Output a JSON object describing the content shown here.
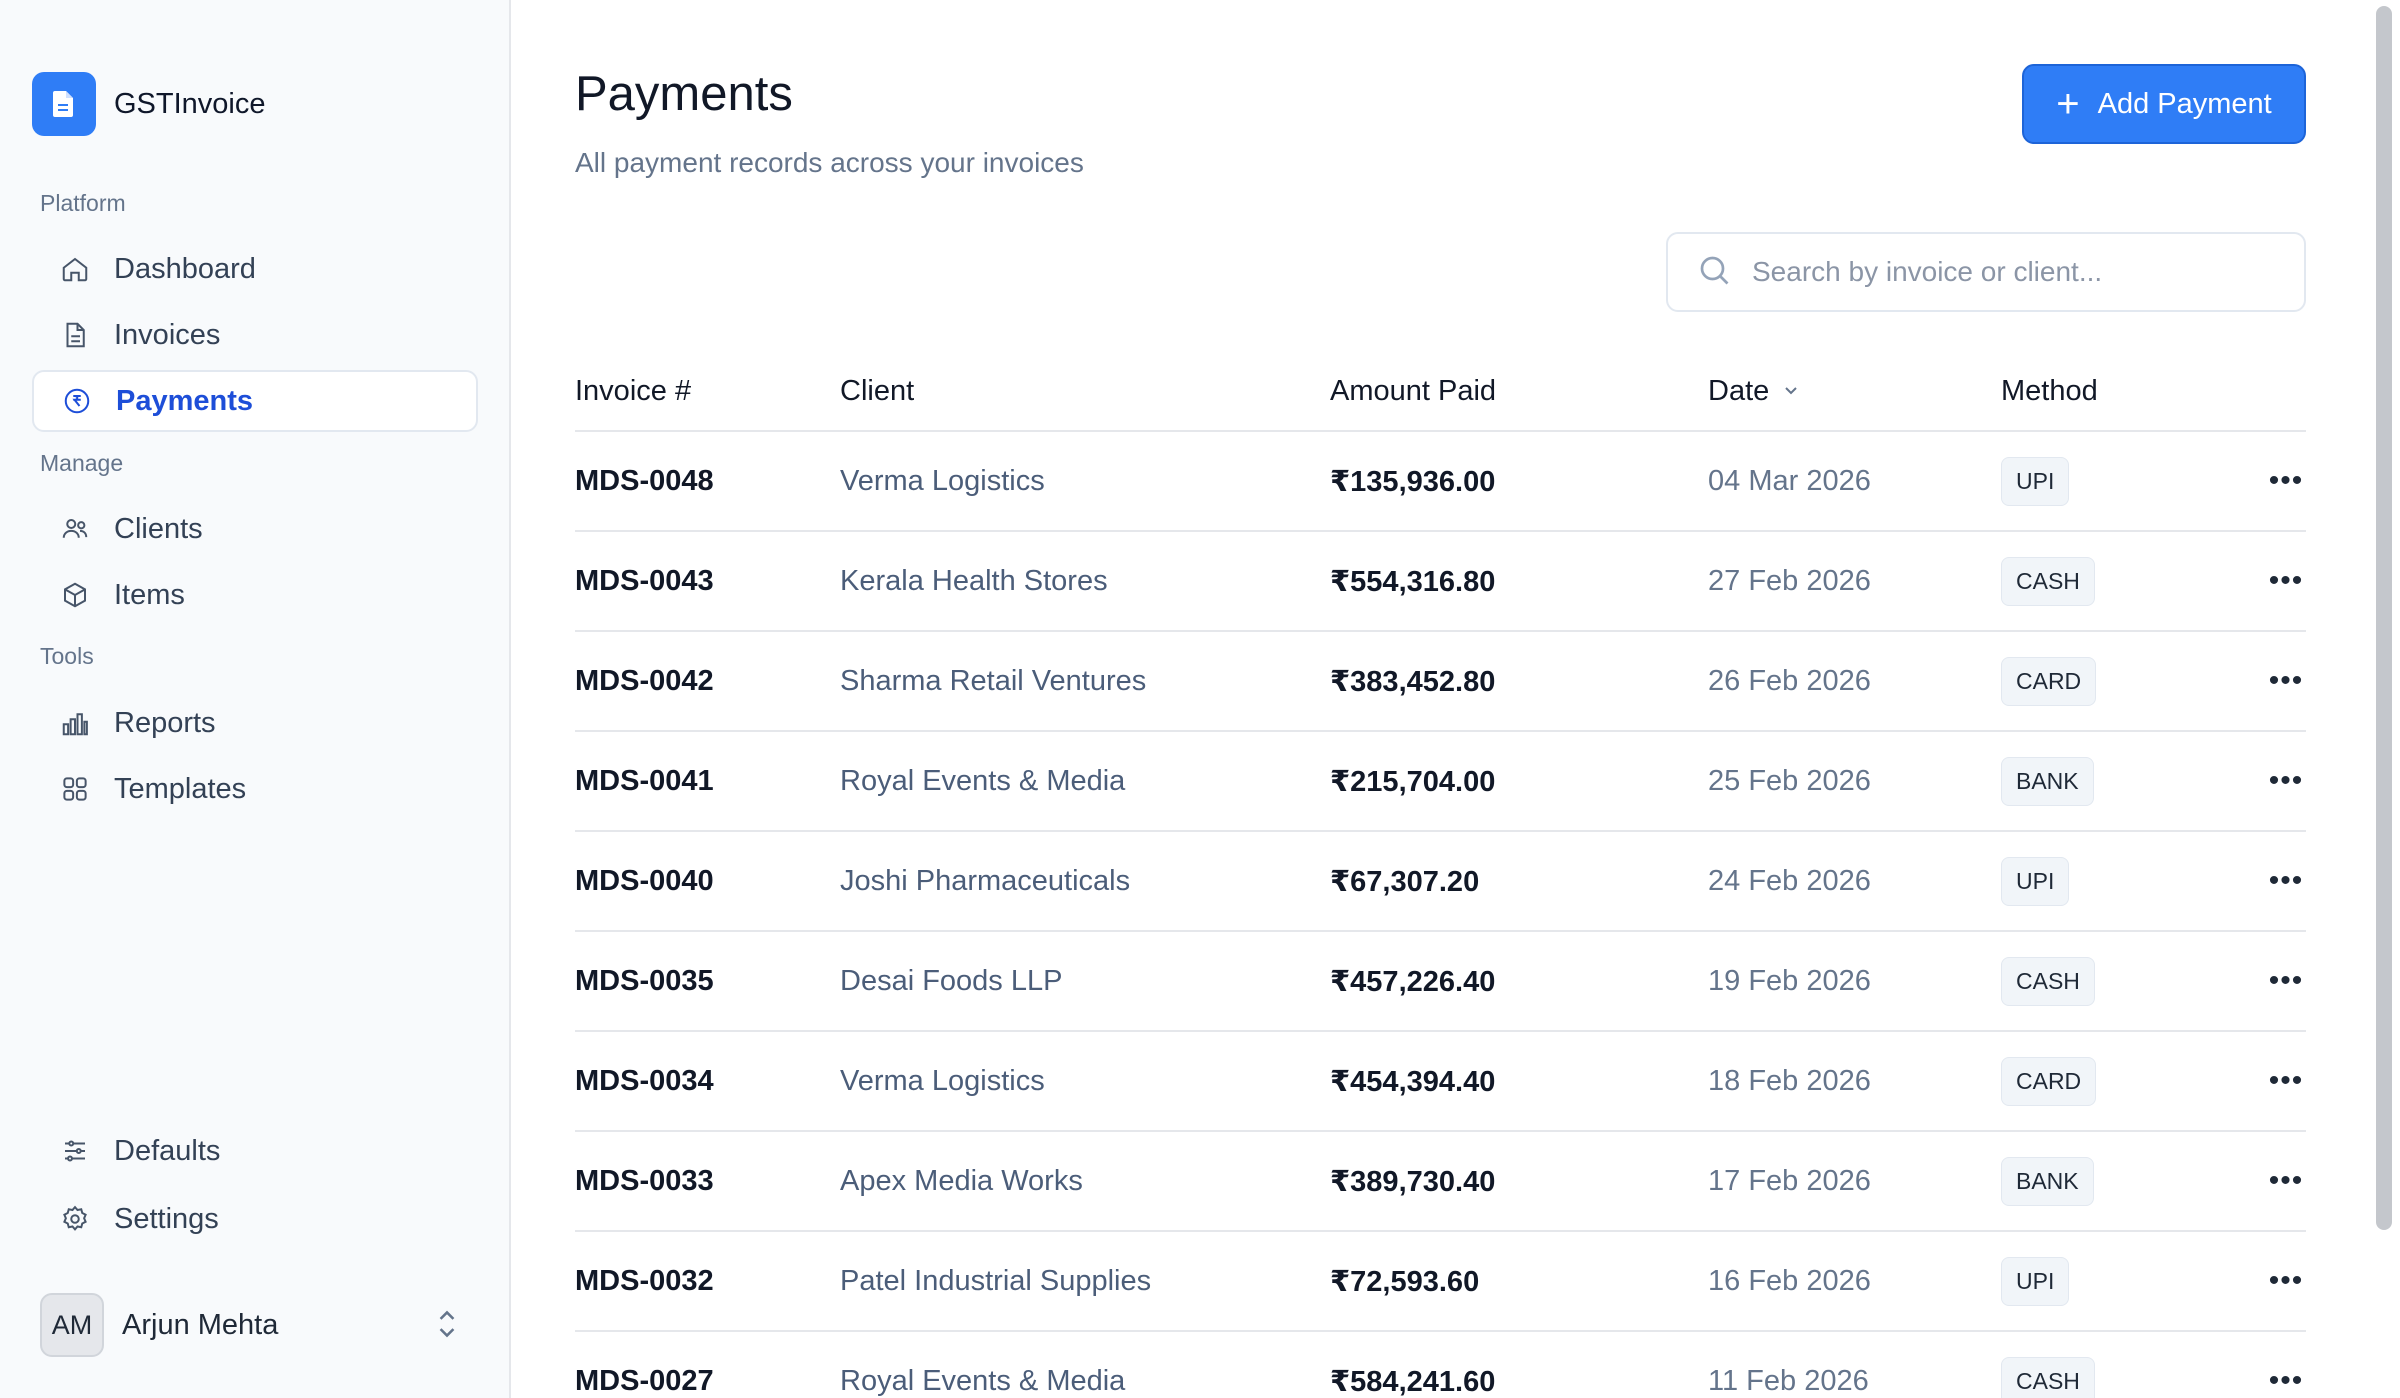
{
  "brand": {
    "name": "GSTInvoice",
    "logo_icon": "document-icon",
    "accent": "#2f7df6"
  },
  "sidebar": {
    "sections": {
      "platform": "Platform",
      "manage": "Manage",
      "tools": "Tools"
    },
    "items": [
      {
        "label": "Dashboard",
        "icon": "home-icon"
      },
      {
        "label": "Invoices",
        "icon": "file-icon"
      },
      {
        "label": "Payments",
        "icon": "rupee-circle-icon",
        "active": true
      },
      {
        "label": "Clients",
        "icon": "users-icon"
      },
      {
        "label": "Items",
        "icon": "box-icon"
      },
      {
        "label": "Reports",
        "icon": "bar-chart-icon"
      },
      {
        "label": "Templates",
        "icon": "grid-icon"
      },
      {
        "label": "Defaults",
        "icon": "sliders-icon"
      },
      {
        "label": "Settings",
        "icon": "gear-icon"
      }
    ],
    "user": {
      "initials": "AM",
      "name": "Arjun Mehta"
    }
  },
  "header": {
    "title": "Payments",
    "subtitle": "All payment records across your invoices",
    "add_button": "Add Payment"
  },
  "search": {
    "placeholder": "Search by invoice or client..."
  },
  "table": {
    "columns": [
      "Invoice #",
      "Client",
      "Amount Paid",
      "Date",
      "Method"
    ],
    "rows": [
      {
        "invoice": "MDS-0048",
        "client": "Verma Logistics",
        "amount": "₹135,936.00",
        "date": "04 Mar 2026",
        "method": "UPI"
      },
      {
        "invoice": "MDS-0043",
        "client": "Kerala Health Stores",
        "amount": "₹554,316.80",
        "date": "27 Feb 2026",
        "method": "CASH"
      },
      {
        "invoice": "MDS-0042",
        "client": "Sharma Retail Ventures",
        "amount": "₹383,452.80",
        "date": "26 Feb 2026",
        "method": "CARD"
      },
      {
        "invoice": "MDS-0041",
        "client": "Royal Events & Media",
        "amount": "₹215,704.00",
        "date": "25 Feb 2026",
        "method": "BANK"
      },
      {
        "invoice": "MDS-0040",
        "client": "Joshi Pharmaceuticals",
        "amount": "₹67,307.20",
        "date": "24 Feb 2026",
        "method": "UPI"
      },
      {
        "invoice": "MDS-0035",
        "client": "Desai Foods LLP",
        "amount": "₹457,226.40",
        "date": "19 Feb 2026",
        "method": "CASH"
      },
      {
        "invoice": "MDS-0034",
        "client": "Verma Logistics",
        "amount": "₹454,394.40",
        "date": "18 Feb 2026",
        "method": "CARD"
      },
      {
        "invoice": "MDS-0033",
        "client": "Apex Media Works",
        "amount": "₹389,730.40",
        "date": "17 Feb 2026",
        "method": "BANK"
      },
      {
        "invoice": "MDS-0032",
        "client": "Patel Industrial Supplies",
        "amount": "₹72,593.60",
        "date": "16 Feb 2026",
        "method": "UPI"
      },
      {
        "invoice": "MDS-0027",
        "client": "Royal Events & Media",
        "amount": "₹584,241.60",
        "date": "11 Feb 2026",
        "method": "CASH"
      }
    ]
  }
}
